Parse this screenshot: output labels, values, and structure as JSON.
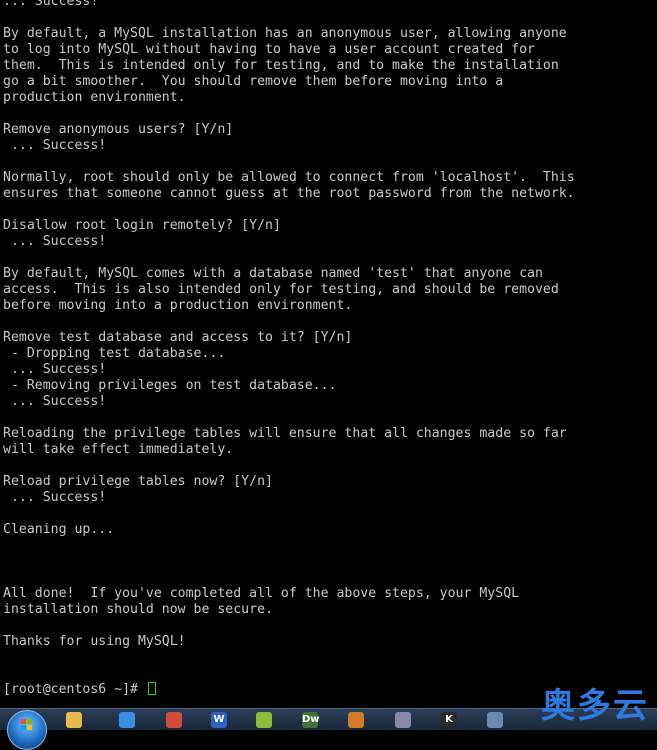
{
  "terminal": {
    "lines": [
      "... Success!",
      "",
      "By default, a MySQL installation has an anonymous user, allowing anyone",
      "to log into MySQL without having to have a user account created for",
      "them.  This is intended only for testing, and to make the installation",
      "go a bit smoother.  You should remove them before moving into a",
      "production environment.",
      "",
      "Remove anonymous users? [Y/n]",
      " ... Success!",
      "",
      "Normally, root should only be allowed to connect from 'localhost'.  This",
      "ensures that someone cannot guess at the root password from the network.",
      "",
      "Disallow root login remotely? [Y/n]",
      " ... Success!",
      "",
      "By default, MySQL comes with a database named 'test' that anyone can",
      "access.  This is also intended only for testing, and should be removed",
      "before moving into a production environment.",
      "",
      "Remove test database and access to it? [Y/n]",
      " - Dropping test database...",
      " ... Success!",
      " - Removing privileges on test database...",
      " ... Success!",
      "",
      "Reloading the privilege tables will ensure that all changes made so far",
      "will take effect immediately.",
      "",
      "Reload privilege tables now? [Y/n]",
      " ... Success!",
      "",
      "Cleaning up...",
      "",
      "",
      "",
      "All done!  If you've completed all of the above steps, your MySQL",
      "installation should now be secure.",
      "",
      "Thanks for using MySQL!",
      "",
      ""
    ],
    "prompt": "[root@centos6 ~]# "
  },
  "taskbar": {
    "items": [
      {
        "name": "start-button"
      },
      {
        "name": "file-explorer-icon",
        "color": "#e8b84a",
        "glyph": ""
      },
      {
        "name": "network-icon",
        "color": "#3a8ee6",
        "glyph": ""
      },
      {
        "name": "chrome-icon",
        "color": "#d44b3a",
        "glyph": ""
      },
      {
        "name": "word-icon",
        "color": "#2b64c0",
        "glyph": "W"
      },
      {
        "name": "app-icon-yellow",
        "color": "#8fbf3a",
        "glyph": ""
      },
      {
        "name": "dreamweaver-icon",
        "color": "#46703a",
        "glyph": "Dw"
      },
      {
        "name": "app-icon-cat",
        "color": "#d07a2a",
        "glyph": ""
      },
      {
        "name": "app-icon-round",
        "color": "#8a8aa8",
        "glyph": ""
      },
      {
        "name": "terminal-icon",
        "color": "#2a2a2a",
        "glyph": "K"
      },
      {
        "name": "settings-icon",
        "color": "#6a8ab0",
        "glyph": ""
      }
    ]
  },
  "watermark": "奥多云"
}
